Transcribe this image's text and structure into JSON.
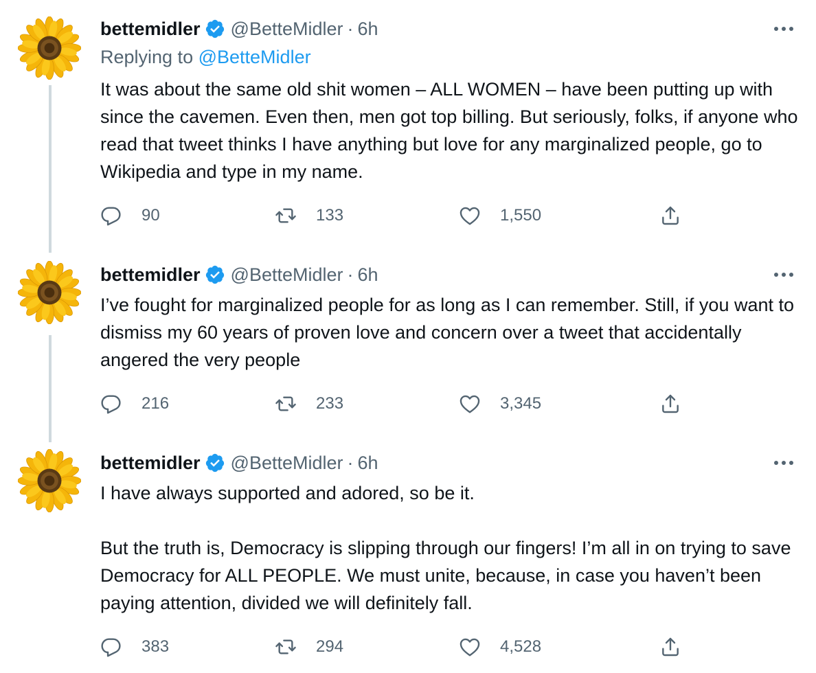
{
  "colors": {
    "text": "#0f1419",
    "muted": "#536471",
    "accent": "#1d9bf0",
    "thread_line": "#cfd9de"
  },
  "icons": {
    "avatar": "sunflower-avatar",
    "verified": "verified-badge-icon",
    "more": "more-dots-icon",
    "reply": "reply-icon",
    "retweet": "retweet-icon",
    "like": "heart-icon",
    "share": "share-icon"
  },
  "tweets": [
    {
      "name": "bettemidler",
      "handle": "@BetteMidler",
      "separator": "·",
      "time": "6h",
      "replying_prefix": "Replying to",
      "replying_to": "@BetteMidler",
      "text": [
        "It was about the same old shit women – ALL WOMEN – have been putting up with since the cavemen. Even then, men got top billing. But seriously, folks, if anyone who read that tweet thinks I have anything but love for any marginalized people, go to Wikipedia and type in my name."
      ],
      "replies": "90",
      "retweets": "133",
      "likes": "1,550"
    },
    {
      "name": "bettemidler",
      "handle": "@BetteMidler",
      "separator": "·",
      "time": "6h",
      "text": [
        "I’ve fought for marginalized people for as long as I can remember. Still, if you want to dismiss my 60 years of proven love and concern over a tweet that accidentally angered the very people"
      ],
      "replies": "216",
      "retweets": "233",
      "likes": "3,345"
    },
    {
      "name": "bettemidler",
      "handle": "@BetteMidler",
      "separator": "·",
      "time": "6h",
      "text": [
        "I have always supported and adored, so be it.",
        "But the truth is, Democracy is slipping through our fingers! I’m all in on trying to save Democracy for ALL PEOPLE. We must unite, because, in case you haven’t been paying attention, divided we will definitely fall."
      ],
      "replies": "383",
      "retweets": "294",
      "likes": "4,528"
    }
  ]
}
